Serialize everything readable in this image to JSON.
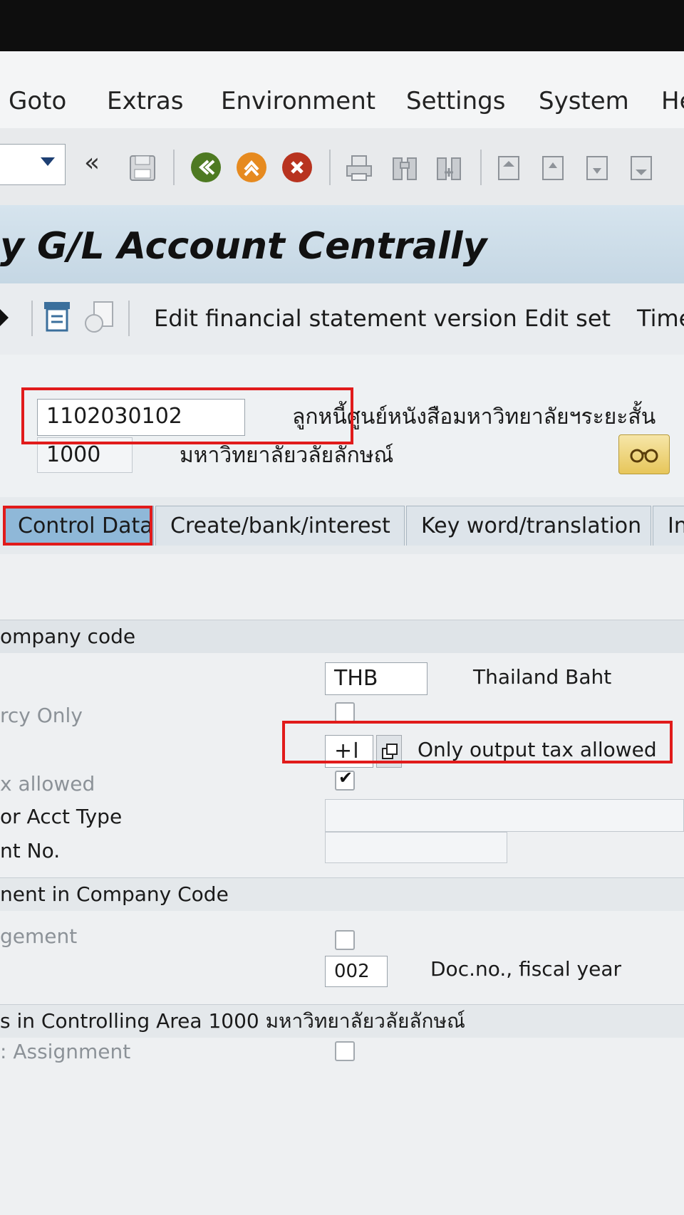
{
  "menu": {
    "goto": "Goto",
    "extras": "Extras",
    "environment": "Environment",
    "settings": "Settings",
    "system": "System",
    "help": "He"
  },
  "toolbar": {
    "collapse": "«",
    "icons": [
      "save-icon",
      "back-icon",
      "exit-icon",
      "cancel-icon",
      "print-icon",
      "find-icon",
      "find-next-icon",
      "first-page-icon",
      "previous-page-icon",
      "next-page-icon",
      "last-page-icon"
    ]
  },
  "title": "y G/L Account Centrally",
  "app_toolbar": {
    "edit_fsv": "Edit financial statement version",
    "edit_set": "Edit set",
    "time": "Time"
  },
  "header": {
    "gl_account": "1102030102",
    "gl_account_text": "ลูกหนี้ศูนย์หนังสือมหาวิทยาลัยฯระยะสั้น",
    "company_code": "1000",
    "company_name": "มหาวิทยาลัยวลัยลักษณ์"
  },
  "tabs": [
    {
      "label": "Control Data",
      "active": true
    },
    {
      "label": "Create/bank/interest",
      "active": false
    },
    {
      "label": "Key word/translation",
      "active": false
    },
    {
      "label": "In",
      "active": false
    }
  ],
  "sections": {
    "company_code": {
      "title": "ompany code",
      "currency": "THB",
      "currency_text": "Thailand Baht",
      "local_crcy_label": "rcy Only",
      "tax_category": "+",
      "tax_category_text": "Only output tax allowed",
      "tax_allowed_label": "x allowed",
      "recon_label": "or Acct Type",
      "alt_account_label": "nt No."
    },
    "mgmt": {
      "title": "nent in Company Code",
      "open_item_label": "gement",
      "sort_key": "002",
      "sort_key_text": "Doc.no., fiscal year"
    },
    "controlling": {
      "title": "s in Controlling Area 1000 มหาวิทยาลัยวลัยลักษณ์",
      "cost_assign_label": ": Assignment"
    }
  },
  "colors": {
    "highlight": "#e11b1b",
    "active_tab": "#8fb8d8",
    "title_bar": "#c5d7e4"
  }
}
